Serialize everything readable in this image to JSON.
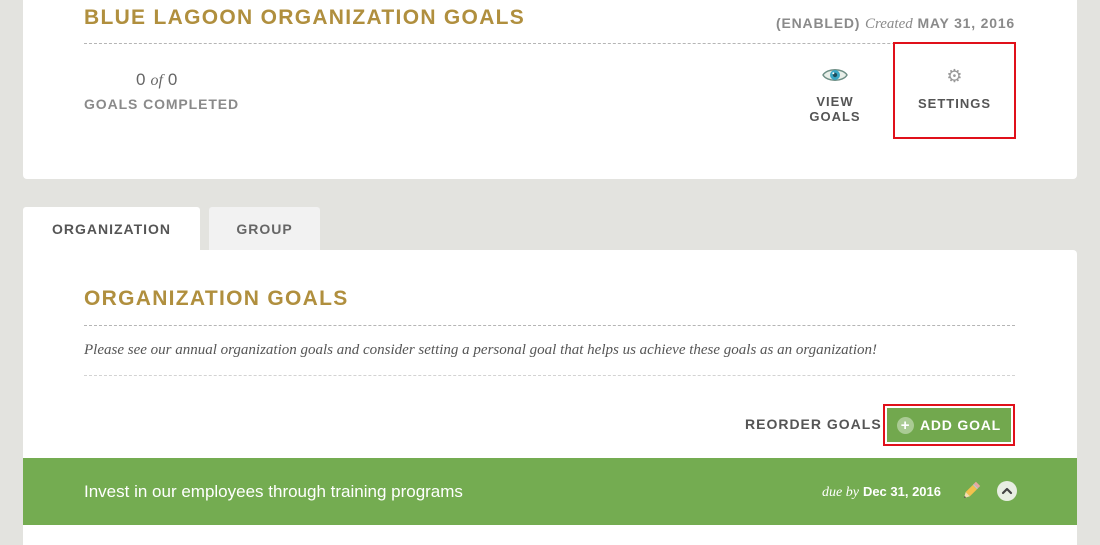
{
  "program": {
    "title": "BLUE LAGOON ORGANIZATION GOALS",
    "status": "(ENABLED)",
    "created_label": "Created",
    "created_date": "MAY 31, 2016",
    "completed_count": "0",
    "of_label": "of",
    "total_count": "0",
    "completed_label": "GOALS COMPLETED",
    "view_goals_label": "VIEW GOALS",
    "view_goals_icon": "eye-icon",
    "settings_label": "SETTINGS",
    "settings_icon": "gear-icon"
  },
  "tabs": [
    {
      "label": "ORGANIZATION",
      "active": true
    },
    {
      "label": "GROUP",
      "active": false
    }
  ],
  "section": {
    "title": "ORGANIZATION GOALS",
    "description": "Please see our annual organization goals and consider setting a personal goal that helps us achieve these goals as an organization!",
    "reorder_label": "REORDER GOALS",
    "add_goal_label": "ADD GOAL",
    "add_goal_icon": "plus-circle-icon"
  },
  "goals": [
    {
      "title": "Invest in our employees through training programs",
      "due_label": "due by",
      "due_date": "Dec 31, 2016",
      "edit_icon": "pencil-icon",
      "collapse_icon": "chevron-up-icon"
    }
  ],
  "colors": {
    "accent_gold": "#b08f3e",
    "goal_green": "#74ac51",
    "highlight_red": "#e0101a",
    "background": "#e3e3df"
  }
}
